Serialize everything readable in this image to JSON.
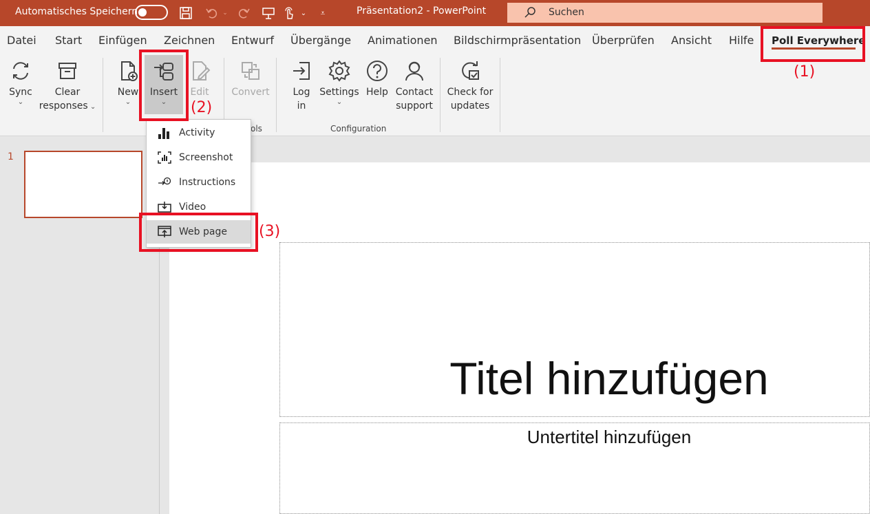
{
  "titlebar": {
    "autosave_label": "Automatisches Speichern",
    "doc_title": "Präsentation2  -  PowerPoint",
    "search_label": "Suchen"
  },
  "tabs": [
    {
      "label": "Datei"
    },
    {
      "label": "Start"
    },
    {
      "label": "Einfügen"
    },
    {
      "label": "Zeichnen"
    },
    {
      "label": "Entwurf"
    },
    {
      "label": "Übergänge"
    },
    {
      "label": "Animationen"
    },
    {
      "label": "Bildschirmpräsentation"
    },
    {
      "label": "Überprüfen"
    },
    {
      "label": "Ansicht"
    },
    {
      "label": "Hilfe"
    },
    {
      "label": "Poll Everywhere",
      "active": true
    }
  ],
  "ribbon": {
    "sync": {
      "line1": "Sync"
    },
    "clear": {
      "line1": "Clear",
      "line2": "responses"
    },
    "new": {
      "line1": "New"
    },
    "insert": {
      "line1": "Insert"
    },
    "edit": {
      "line1": "Edit"
    },
    "convert": {
      "line1": "Convert"
    },
    "tools_group_fragment": "ols",
    "login": {
      "line1": "Log",
      "line2": "in"
    },
    "settings": {
      "line1": "Settings"
    },
    "help": {
      "line1": "Help"
    },
    "contact": {
      "line1": "Contact",
      "line2": "support"
    },
    "updates": {
      "line1": "Check for",
      "line2": "updates"
    },
    "configuration_group": "Configuration"
  },
  "insert_menu": {
    "items": [
      {
        "label": "Activity",
        "icon": "bar-chart-icon"
      },
      {
        "label": "Screenshot",
        "icon": "screenshot-icon"
      },
      {
        "label": "Instructions",
        "icon": "instructions-icon"
      },
      {
        "label": "Video",
        "icon": "video-icon"
      },
      {
        "label": "Web page",
        "icon": "web-page-icon",
        "highlighted": true
      }
    ]
  },
  "slides": {
    "thumbnail_number": "1",
    "title_placeholder": "Titel hinzufügen",
    "subtitle_placeholder": "Untertitel hinzufügen"
  },
  "annotations": {
    "step1": "(1)",
    "step2": "(2)",
    "step3": "(3)"
  },
  "colors": {
    "accent": "#b7472a",
    "search_bg": "#f9c3ad",
    "annotation_red": "#e81123"
  }
}
